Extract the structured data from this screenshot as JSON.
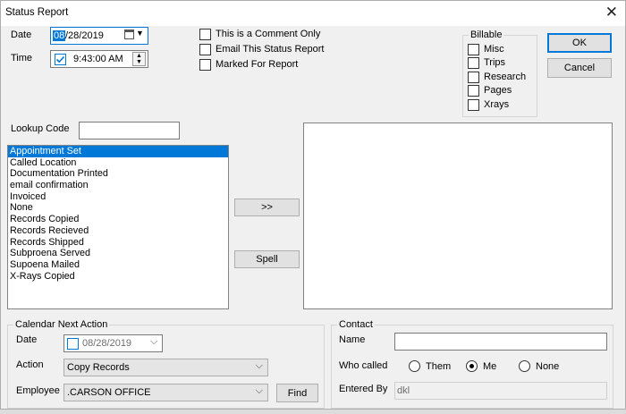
{
  "window": {
    "title": "Status Report",
    "close_glyph": "✕"
  },
  "top": {
    "date_label": "Date",
    "date_value_highlight": "08",
    "date_value_rest": "/28/2019",
    "time_label": "Time",
    "time_value": "9:43:00 AM"
  },
  "options": {
    "comment_only": "This is a Comment Only",
    "email_report": "Email This Status Report",
    "marked_for_report": "Marked For Report"
  },
  "billable": {
    "title": "Billable",
    "items": [
      "Misc",
      "Trips",
      "Research",
      "Pages",
      "Xrays"
    ]
  },
  "buttons": {
    "ok": "OK",
    "cancel": "Cancel",
    "transfer": ">>",
    "spell": "Spell",
    "find": "Find"
  },
  "lookup": {
    "label": "Lookup Code",
    "value": "",
    "items": [
      "Appointment Set",
      "Called Location",
      "Documentation Printed",
      "email confirmation",
      "Invoiced",
      "None",
      "Records Copied",
      "Records Recieved",
      "Records Shipped",
      "Subproena Served",
      "Supoena Mailed",
      "X-Rays Copied"
    ],
    "selected_index": 0
  },
  "calendar": {
    "title": "Calendar Next Action",
    "date_label": "Date",
    "date_value": "08/28/2019",
    "action_label": "Action",
    "action_value": "Copy Records",
    "employee_label": "Employee",
    "employee_value": ".CARSON OFFICE"
  },
  "contact": {
    "title": "Contact",
    "name_label": "Name",
    "name_value": "",
    "who_called_label": "Who called",
    "who_options": [
      "Them",
      "Me",
      "None"
    ],
    "who_selected": "Me",
    "entered_by_label": "Entered By",
    "entered_by_value": "dkl"
  }
}
